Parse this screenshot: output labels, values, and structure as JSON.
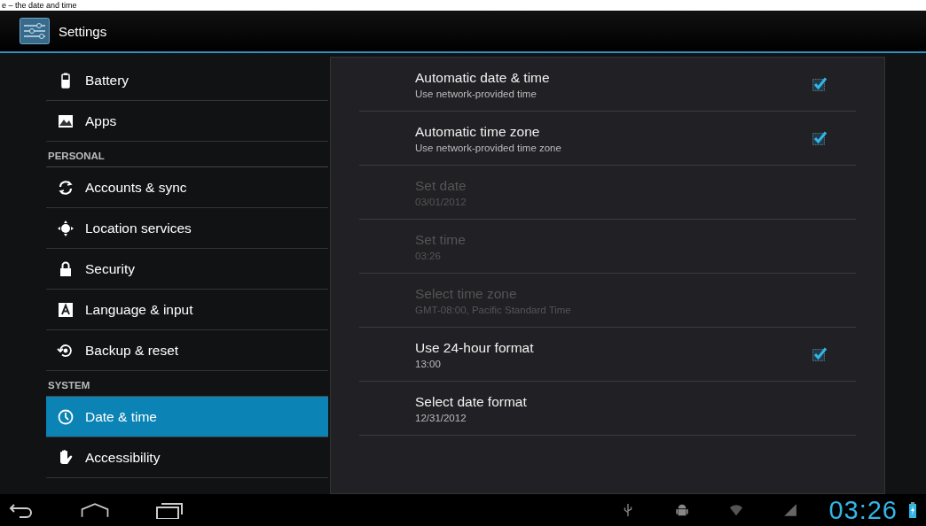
{
  "caption": "e – the date and time",
  "action_bar": {
    "title": "Settings"
  },
  "sidebar": {
    "items": [
      {
        "kind": "item",
        "label": "Battery",
        "selected": false
      },
      {
        "kind": "item",
        "label": "Apps",
        "selected": false
      },
      {
        "kind": "header",
        "label": "PERSONAL"
      },
      {
        "kind": "item",
        "label": "Accounts & sync",
        "selected": false
      },
      {
        "kind": "item",
        "label": "Location services",
        "selected": false
      },
      {
        "kind": "item",
        "label": "Security",
        "selected": false
      },
      {
        "kind": "item",
        "label": "Language & input",
        "selected": false
      },
      {
        "kind": "item",
        "label": "Backup & reset",
        "selected": false
      },
      {
        "kind": "header",
        "label": "SYSTEM"
      },
      {
        "kind": "item",
        "label": "Date & time",
        "selected": true
      },
      {
        "kind": "item",
        "label": "Accessibility",
        "selected": false
      }
    ]
  },
  "settings": [
    {
      "kind": "checkbox",
      "title": "Automatic date & time",
      "summary": "Use network-provided time",
      "disabled": false,
      "checked": true
    },
    {
      "kind": "checkbox",
      "title": "Automatic time zone",
      "summary": "Use network-provided time zone",
      "disabled": false,
      "checked": true
    },
    {
      "kind": "plain",
      "title": "Set date",
      "summary": "03/01/2012",
      "disabled": true
    },
    {
      "kind": "plain",
      "title": "Set time",
      "summary": "03:26",
      "disabled": true
    },
    {
      "kind": "plain",
      "title": "Select time zone",
      "summary": "GMT-08:00, Pacific Standard Time",
      "disabled": true
    },
    {
      "kind": "checkbox",
      "title": "Use 24-hour format",
      "summary": "13:00",
      "disabled": false,
      "checked": true
    },
    {
      "kind": "plain",
      "title": "Select date format",
      "summary": "12/31/2012",
      "disabled": false
    }
  ],
  "nav_bar": {
    "clock": "03:26"
  }
}
